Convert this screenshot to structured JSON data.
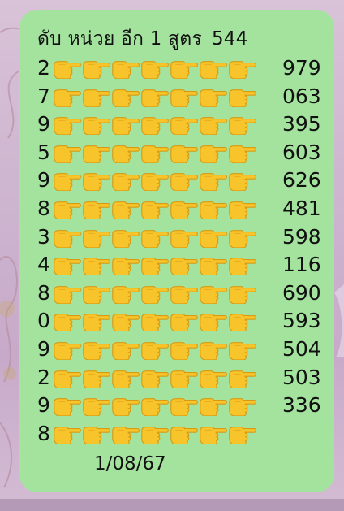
{
  "header": {
    "title": "ดับ  หน่วย อีก 1 สูตร",
    "code": "544"
  },
  "rows": [
    {
      "lead": "2",
      "num": "979"
    },
    {
      "lead": "7",
      "num": "063"
    },
    {
      "lead": "9",
      "num": "395"
    },
    {
      "lead": "5",
      "num": "603"
    },
    {
      "lead": "9",
      "num": "626"
    },
    {
      "lead": "8",
      "num": "481"
    },
    {
      "lead": "3",
      "num": "598"
    },
    {
      "lead": "4",
      "num": "116"
    },
    {
      "lead": "8",
      "num": "690"
    },
    {
      "lead": "0",
      "num": "593"
    },
    {
      "lead": "9",
      "num": "504"
    },
    {
      "lead": "2",
      "num": "503"
    },
    {
      "lead": "9",
      "num": "336"
    },
    {
      "lead": "8",
      "num": ""
    }
  ],
  "pointer_icon": "backhand-index-pointing-right-icon",
  "pointers_per_row": 7,
  "date": "1/08/67",
  "colors": {
    "bubble": "#a4e39e",
    "pointer": "#f7c52b",
    "background": "#cdb4cf"
  }
}
